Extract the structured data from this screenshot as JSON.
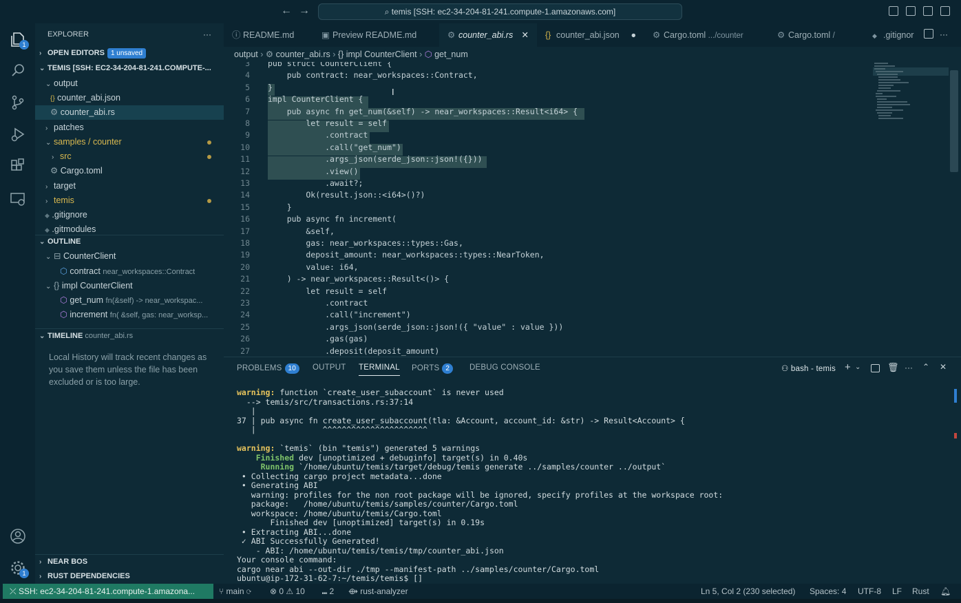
{
  "titlebar": {
    "command_center": "temis [SSH: ec2-34-204-81-241.compute-1.amazonaws.com]"
  },
  "activity": {
    "explorer_badge": "1",
    "settings_badge": "1"
  },
  "sidebar": {
    "explorer_title": "EXPLORER",
    "open_editors": "OPEN EDITORS",
    "unsaved_badge": "1 unsaved",
    "workspace_title": "TEMIS [SSH: EC2-34-204-81-241.COMPUTE-...",
    "items": [
      {
        "label": "output"
      },
      {
        "label": "counter_abi.json",
        "icon": "{}"
      },
      {
        "label": "counter_abi.rs",
        "icon": "⚙"
      },
      {
        "label": "patches"
      },
      {
        "label": "samples / counter"
      },
      {
        "label": "src"
      },
      {
        "label": "Cargo.toml",
        "icon": "⚙"
      },
      {
        "label": "target"
      },
      {
        "label": "temis"
      },
      {
        "label": ".gitignore",
        "icon": "◆"
      },
      {
        "label": ".gitmodules",
        "icon": "◆"
      }
    ],
    "outline_title": "OUTLINE",
    "outline": [
      {
        "label": "CounterClient",
        "detail": ""
      },
      {
        "label": "contract",
        "detail": "near_workspaces::Contract"
      },
      {
        "label": "impl CounterClient",
        "detail": ""
      },
      {
        "label": "get_num",
        "detail": "fn(&self) -> near_workspac..."
      },
      {
        "label": "increment",
        "detail": "fn( &self, gas: near_worksp..."
      }
    ],
    "timeline_title": "TIMELINE",
    "timeline_file": "counter_abi.rs",
    "timeline_text": "Local History will track recent changes as you save them unless the file has been excluded or is too large.",
    "near_bos": "NEAR BOS",
    "rust_deps": "RUST DEPENDENCIES"
  },
  "tabs": [
    {
      "label": "README.md",
      "icon": "ⓘ"
    },
    {
      "label": "Preview README.md",
      "icon": "▣"
    },
    {
      "label": "counter_abi.rs",
      "icon": "⚙"
    },
    {
      "label": "counter_abi.json",
      "icon": "{}"
    },
    {
      "label": "Cargo.toml",
      "sub": ".../counter",
      "icon": "⚙"
    },
    {
      "label": "Cargo.toml",
      "sub": "/",
      "icon": "⚙"
    },
    {
      "label": ".gitignor",
      "icon": "◆"
    }
  ],
  "breadcrumb": [
    "output",
    "counter_abi.rs",
    "{} impl CounterClient",
    "get_num"
  ],
  "code": [
    {
      "n": "3",
      "t": "pub struct CounterClient {"
    },
    {
      "n": "4",
      "t": "    pub contract: near_workspaces::Contract,"
    },
    {
      "n": "5",
      "t": "}"
    },
    {
      "n": "6",
      "t": "impl CounterClient {"
    },
    {
      "n": "7",
      "t": "    pub async fn get_num(&self) -> near_workspaces::Result<i64> {"
    },
    {
      "n": "8",
      "t": "        let result = self"
    },
    {
      "n": "9",
      "t": "            .contract"
    },
    {
      "n": "10",
      "t": "            .call(\"get_num\")"
    },
    {
      "n": "11",
      "t": "            .args_json(serde_json::json!({}))"
    },
    {
      "n": "12",
      "t": "            .view()"
    },
    {
      "n": "13",
      "t": "            .await?;"
    },
    {
      "n": "14",
      "t": "        Ok(result.json::<i64>()?)"
    },
    {
      "n": "15",
      "t": "    }"
    },
    {
      "n": "16",
      "t": "    pub async fn increment("
    },
    {
      "n": "17",
      "t": "        &self,"
    },
    {
      "n": "18",
      "t": "        gas: near_workspaces::types::Gas,"
    },
    {
      "n": "19",
      "t": "        deposit_amount: near_workspaces::types::NearToken,"
    },
    {
      "n": "20",
      "t": "        value: i64,"
    },
    {
      "n": "21",
      "t": "    ) -> near_workspaces::Result<()> {"
    },
    {
      "n": "22",
      "t": "        let result = self"
    },
    {
      "n": "23",
      "t": "            .contract"
    },
    {
      "n": "24",
      "t": "            .call(\"increment\")"
    },
    {
      "n": "25",
      "t": "            .args_json(serde_json::json!({ \"value\" : value }))"
    },
    {
      "n": "26",
      "t": "            .gas(gas)"
    },
    {
      "n": "27",
      "t": "            .deposit(deposit_amount)"
    }
  ],
  "panel": {
    "tabs": [
      {
        "label": "PROBLEMS",
        "badge": "10"
      },
      {
        "label": "OUTPUT",
        "badge": ""
      },
      {
        "label": "TERMINAL",
        "badge": ""
      },
      {
        "label": "PORTS",
        "badge": "2"
      },
      {
        "label": "DEBUG CONSOLE",
        "badge": ""
      }
    ],
    "terminal_name": "bash - temis"
  },
  "terminal": [
    {
      "p": "warning:",
      "t": " function `create_user_subaccount` is never used"
    },
    {
      "p": "",
      "t": "  --> temis/src/transactions.rs:37:14"
    },
    {
      "p": "",
      "t": "   |"
    },
    {
      "p": "",
      "t": "37 | pub async fn create_user_subaccount(tla: &Account, account_id: &str) -> Result<Account> {"
    },
    {
      "p": "",
      "t": "   |              ^^^^^^^^^^^^^^^^^^^^^^"
    },
    {
      "p": "",
      "t": ""
    },
    {
      "p": "warning:",
      "t": " `temis` (bin \"temis\") generated 5 warnings"
    },
    {
      "p": "    Finished",
      "t": " dev [unoptimized + debuginfo] target(s) in 0.40s"
    },
    {
      "p": "     Running",
      "t": " `/home/ubuntu/temis/target/debug/temis generate ../samples/counter ../output`"
    },
    {
      "p": "",
      "t": " • Collecting cargo project metadata...done"
    },
    {
      "p": "",
      "t": " • Generating ABI"
    },
    {
      "p": "",
      "t": "   warning: profiles for the non root package will be ignored, specify profiles at the workspace root:"
    },
    {
      "p": "",
      "t": "   package:   /home/ubuntu/temis/samples/counter/Cargo.toml"
    },
    {
      "p": "",
      "t": "   workspace: /home/ubuntu/temis/Cargo.toml"
    },
    {
      "p": "",
      "t": "       Finished dev [unoptimized] target(s) in 0.19s"
    },
    {
      "p": "",
      "t": " • Extracting ABI...done"
    },
    {
      "p": "",
      "t": " ✓ ABI Successfully Generated!"
    },
    {
      "p": "",
      "t": "    - ABI: /home/ubuntu/temis/temis/tmp/counter_abi.json"
    },
    {
      "p": "",
      "t": "Your console command:"
    },
    {
      "p": "",
      "t": "cargo near abi --out-dir ./tmp --manifest-path ../samples/counter/Cargo.toml"
    },
    {
      "p": "",
      "t": "ubuntu@ip-172-31-62-7:~/temis/temis$ []"
    }
  ],
  "status": {
    "remote": "SSH: ec2-34-204-81-241.compute-1.amazona...",
    "branch": "main",
    "problems": "⊗ 0 ⚠ 10",
    "ports": "2",
    "analyzer": "rust-analyzer",
    "position": "Ln 5, Col 2 (230 selected)",
    "spaces": "Spaces: 4",
    "encoding": "UTF-8",
    "eol": "LF",
    "language": "Rust"
  },
  "colors": {
    "accent": "#2f7fd1",
    "remote": "#1f7a63",
    "background": "#0e2a36"
  }
}
